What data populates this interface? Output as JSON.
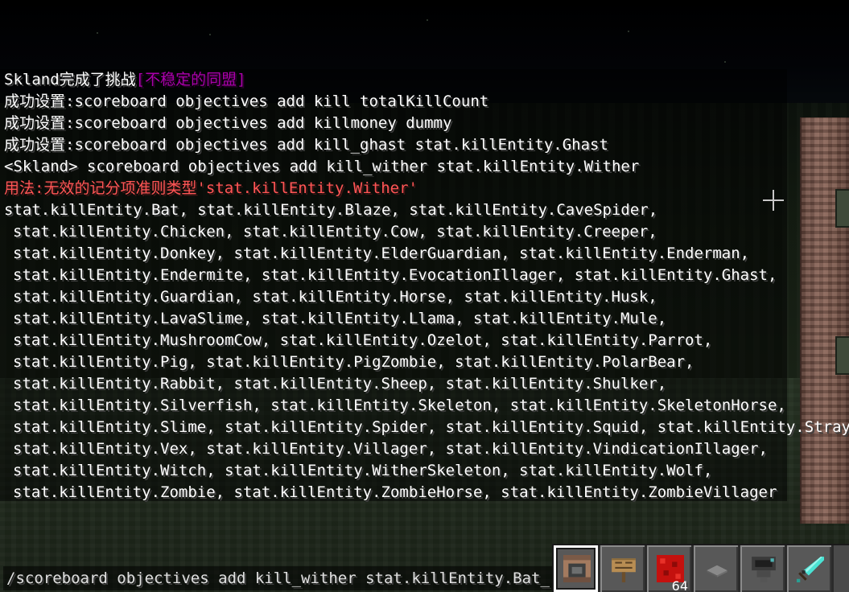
{
  "chat": {
    "lines": [
      {
        "segments": [
          {
            "text": "Skland完成了挑战",
            "color": "white"
          },
          {
            "text": "[不稳定的同盟]",
            "color": "purple"
          }
        ]
      },
      {
        "text": "成功设置:scoreboard objectives add kill totalKillCount"
      },
      {
        "text": "成功设置:scoreboard objectives add killmoney dummy"
      },
      {
        "text": "成功设置:scoreboard objectives add kill_ghast stat.killEntity.Ghast"
      },
      {
        "text": "<Skland> scoreboard objectives add kill_wither stat.killEntity.Wither"
      },
      {
        "text": "用法:无效的记分项准则类型'stat.killEntity.Wither'"
      },
      {
        "text": "stat.killEntity.Bat, stat.killEntity.Blaze, stat.killEntity.CaveSpider,"
      },
      {
        "text": "stat.killEntity.Chicken, stat.killEntity.Cow, stat.killEntity.Creeper,"
      },
      {
        "text": "stat.killEntity.Donkey, stat.killEntity.ElderGuardian, stat.killEntity.Enderman,"
      },
      {
        "text": "stat.killEntity.Endermite, stat.killEntity.EvocationIllager, stat.killEntity.Ghast,"
      },
      {
        "text": "stat.killEntity.Guardian, stat.killEntity.Horse, stat.killEntity.Husk,"
      },
      {
        "text": "stat.killEntity.LavaSlime, stat.killEntity.Llama, stat.killEntity.Mule,"
      },
      {
        "text": "stat.killEntity.MushroomCow, stat.killEntity.Ozelot, stat.killEntity.Parrot,"
      },
      {
        "text": "stat.killEntity.Pig, stat.killEntity.PigZombie, stat.killEntity.PolarBear,"
      },
      {
        "text": "stat.killEntity.Rabbit, stat.killEntity.Sheep, stat.killEntity.Shulker,"
      },
      {
        "text": "stat.killEntity.Silverfish, stat.killEntity.Skeleton, stat.killEntity.SkeletonHorse,"
      },
      {
        "text": "stat.killEntity.Slime, stat.killEntity.Spider, stat.killEntity.Squid, stat.killEntity.Stray,"
      },
      {
        "text": "stat.killEntity.Vex, stat.killEntity.Villager, stat.killEntity.VindicationIllager,"
      },
      {
        "text": "stat.killEntity.Witch, stat.killEntity.WitherSkeleton, stat.killEntity.Wolf,"
      },
      {
        "text": "stat.killEntity.Zombie, stat.killEntity.ZombieHorse, stat.killEntity.ZombieVillager"
      }
    ]
  },
  "command_input": {
    "value": "/scoreboard objectives add kill_wither stat.killEntity.Bat_"
  },
  "hotbar": {
    "slots": [
      {
        "item": "command-block-icon",
        "selected": true
      },
      {
        "item": "sign-icon"
      },
      {
        "item": "redstone-block-icon",
        "count": "64"
      },
      {
        "item": "stone-pressure-plate-icon"
      },
      {
        "item": "hopper-icon"
      },
      {
        "item": "diamond-sword-icon"
      }
    ]
  },
  "colors": {
    "chat_text": "#ffffff",
    "achievement": "#aa00aa",
    "error": "#ff5555"
  }
}
